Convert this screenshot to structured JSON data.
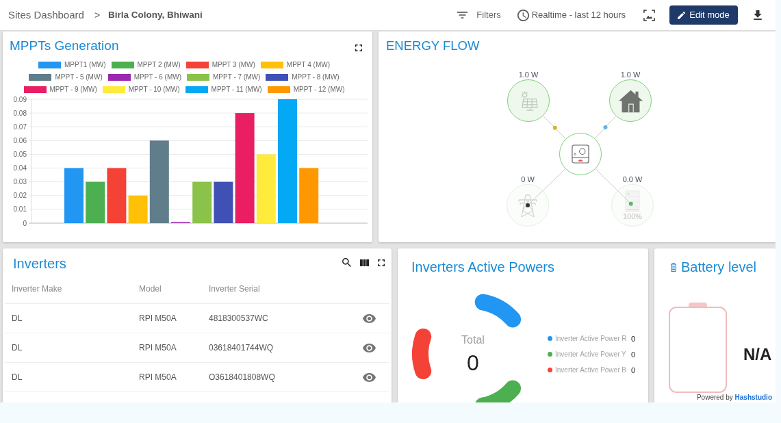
{
  "header": {
    "breadcrumb": {
      "parent": "Sites Dashboard",
      "separator": ">",
      "current": "Birla Colony, Bhiwani"
    },
    "filters_label": "Filters",
    "time_range": "Realtime - last 12 hours",
    "edit_button": "Edit mode"
  },
  "mppt_card": {
    "title": "MPPTs Generation",
    "chart_data": {
      "type": "bar",
      "series": [
        {
          "name": "MPPT1 (MW)",
          "color": "#2196f3",
          "values": [
            0.04
          ]
        },
        {
          "name": "MPPT 2 (MW)",
          "color": "#4caf50",
          "values": [
            0.03
          ]
        },
        {
          "name": "MPPT 3 (MW)",
          "color": "#f44336",
          "values": [
            0.04
          ]
        },
        {
          "name": "MPPT 4 (MW)",
          "color": "#ffc107",
          "values": [
            0.02
          ]
        },
        {
          "name": "MPPT - 5 (MW)",
          "color": "#607d8b",
          "values": [
            0.06
          ]
        },
        {
          "name": "MPPT - 6 (MW)",
          "color": "#9c27b0",
          "values": [
            0
          ]
        },
        {
          "name": "MPPT - 7 (MW)",
          "color": "#8bc34a",
          "values": [
            0.03
          ]
        },
        {
          "name": "MPPT - 8 (MW)",
          "color": "#3f51b5",
          "values": [
            0.03
          ]
        },
        {
          "name": "MPPT - 9 (MW)",
          "color": "#e91e63",
          "values": [
            0.08
          ]
        },
        {
          "name": "MPPT - 10 (MW)",
          "color": "#ffeb3b",
          "values": [
            0.05
          ]
        },
        {
          "name": "MPPT - 11 (MW)",
          "color": "#03a9f4",
          "values": [
            0.09
          ]
        },
        {
          "name": "MPPT - 12 (MW)",
          "color": "#ff9800",
          "values": [
            0.04
          ]
        }
      ],
      "ylim": [
        0,
        0.09
      ],
      "yticks": [
        0,
        0.01,
        0.02,
        0.03,
        0.04,
        0.05,
        0.06,
        0.07,
        0.08,
        0.09
      ],
      "grid": true,
      "legend": true
    }
  },
  "energy_flow": {
    "title": "ENERGY FLOW",
    "nodes": [
      {
        "kind": "solar",
        "reading": "1.0 W",
        "dimmed": false,
        "color": "#e0b125"
      },
      {
        "kind": "home",
        "reading": "1.0 W",
        "dimmed": false,
        "color": "#6aaee0"
      },
      {
        "kind": "inverter",
        "dimmed": false
      },
      {
        "kind": "grid",
        "reading": "0 W",
        "dimmed": true,
        "color": "#333333"
      },
      {
        "kind": "battery",
        "reading": "0.0 W",
        "dimmed": true,
        "color": "#5cb85c",
        "charge": "100%"
      }
    ]
  },
  "inverters": {
    "title": "Inverters",
    "columns": [
      "Inverter Make",
      "Model",
      "Inverter Serial"
    ],
    "rows": [
      [
        "DL",
        "RPI M50A",
        "4818300537WC"
      ],
      [
        "DL",
        "RPI M50A",
        "03618401744WQ"
      ],
      [
        "DL",
        "RPI M50A",
        "O3618401808WQ"
      ]
    ]
  },
  "active_powers": {
    "title": "Inverters Active Powers",
    "total_label": "Total",
    "total_value": "0",
    "legend": [
      {
        "label": "Inverter Active Power R",
        "value": "0",
        "color": "#2196f3"
      },
      {
        "label": "Inverter Active Power Y",
        "value": "0",
        "color": "#4caf50"
      },
      {
        "label": "Inverter Active Power B",
        "value": "0",
        "color": "#f44336"
      }
    ]
  },
  "battery": {
    "title": "Battery level",
    "value": "N/A",
    "powered_by": "Powered by **Hashstudio**"
  }
}
